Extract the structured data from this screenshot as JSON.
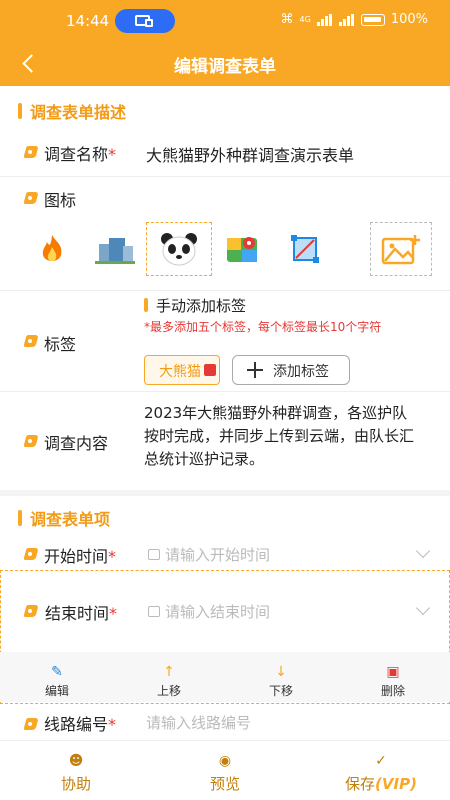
{
  "status_bar": {
    "time": "14:44",
    "battery": "100%",
    "network": "4G"
  },
  "nav": {
    "title": "编辑调查表单"
  },
  "section1": {
    "title": "调查表单描述"
  },
  "survey_name": {
    "label": "调查名称",
    "required": "*",
    "value": "大熊猫野外种群调查演示表单"
  },
  "icon_field": {
    "label": "图标",
    "icons": [
      "fire-icon",
      "building-icon",
      "panda-icon",
      "map-pin-icon",
      "crop-icon",
      "image-add-icon"
    ],
    "selected": "panda-icon"
  },
  "tags": {
    "label": "标签",
    "manual_title": "手动添加标签",
    "hint": "*最多添加五个标签，每个标签最长10个字符",
    "items": [
      "大熊猫"
    ],
    "add_button": "添加标签"
  },
  "content": {
    "label": "调查内容",
    "value": "2023年大熊猫野外种群调查，各巡护队按时完成，并同步上传到云端，由队长汇总统计巡护记录。"
  },
  "section2": {
    "title": "调查表单项"
  },
  "items": [
    {
      "label": "开始时间",
      "required": "*",
      "placeholder": "请输入开始时间"
    },
    {
      "label": "结束时间",
      "required": "*",
      "placeholder": "请输入结束时间"
    },
    {
      "label": "线路编号",
      "required": "*",
      "placeholder": "请输入线路编号"
    }
  ],
  "item_toolbar": {
    "edit": "编辑",
    "up": "上移",
    "down": "下移",
    "delete": "删除"
  },
  "bottom": {
    "help": "协助",
    "preview": "预览",
    "save": "保存",
    "vip": "(VIP)"
  },
  "colors": {
    "accent": "#f9a825",
    "accent_text": "#f29b17",
    "required": "#e53935"
  }
}
